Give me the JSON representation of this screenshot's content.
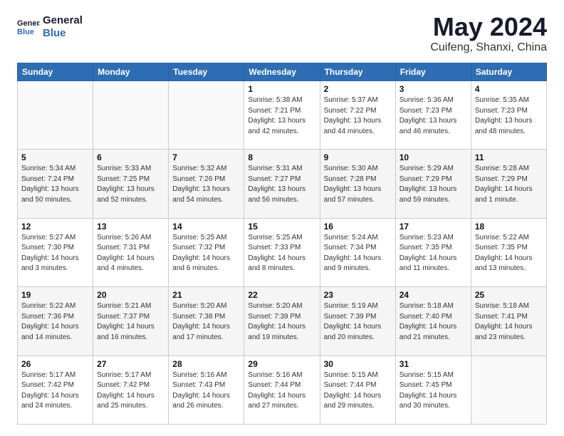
{
  "header": {
    "logo_line1": "General",
    "logo_line2": "Blue",
    "month": "May 2024",
    "location": "Cuifeng, Shanxi, China"
  },
  "weekdays": [
    "Sunday",
    "Monday",
    "Tuesday",
    "Wednesday",
    "Thursday",
    "Friday",
    "Saturday"
  ],
  "weeks": [
    [
      {
        "day": "",
        "info": ""
      },
      {
        "day": "",
        "info": ""
      },
      {
        "day": "",
        "info": ""
      },
      {
        "day": "1",
        "info": "Sunrise: 5:38 AM\nSunset: 7:21 PM\nDaylight: 13 hours\nand 42 minutes."
      },
      {
        "day": "2",
        "info": "Sunrise: 5:37 AM\nSunset: 7:22 PM\nDaylight: 13 hours\nand 44 minutes."
      },
      {
        "day": "3",
        "info": "Sunrise: 5:36 AM\nSunset: 7:23 PM\nDaylight: 13 hours\nand 46 minutes."
      },
      {
        "day": "4",
        "info": "Sunrise: 5:35 AM\nSunset: 7:23 PM\nDaylight: 13 hours\nand 48 minutes."
      }
    ],
    [
      {
        "day": "5",
        "info": "Sunrise: 5:34 AM\nSunset: 7:24 PM\nDaylight: 13 hours\nand 50 minutes."
      },
      {
        "day": "6",
        "info": "Sunrise: 5:33 AM\nSunset: 7:25 PM\nDaylight: 13 hours\nand 52 minutes."
      },
      {
        "day": "7",
        "info": "Sunrise: 5:32 AM\nSunset: 7:26 PM\nDaylight: 13 hours\nand 54 minutes."
      },
      {
        "day": "8",
        "info": "Sunrise: 5:31 AM\nSunset: 7:27 PM\nDaylight: 13 hours\nand 56 minutes."
      },
      {
        "day": "9",
        "info": "Sunrise: 5:30 AM\nSunset: 7:28 PM\nDaylight: 13 hours\nand 57 minutes."
      },
      {
        "day": "10",
        "info": "Sunrise: 5:29 AM\nSunset: 7:29 PM\nDaylight: 13 hours\nand 59 minutes."
      },
      {
        "day": "11",
        "info": "Sunrise: 5:28 AM\nSunset: 7:29 PM\nDaylight: 14 hours\nand 1 minute."
      }
    ],
    [
      {
        "day": "12",
        "info": "Sunrise: 5:27 AM\nSunset: 7:30 PM\nDaylight: 14 hours\nand 3 minutes."
      },
      {
        "day": "13",
        "info": "Sunrise: 5:26 AM\nSunset: 7:31 PM\nDaylight: 14 hours\nand 4 minutes."
      },
      {
        "day": "14",
        "info": "Sunrise: 5:25 AM\nSunset: 7:32 PM\nDaylight: 14 hours\nand 6 minutes."
      },
      {
        "day": "15",
        "info": "Sunrise: 5:25 AM\nSunset: 7:33 PM\nDaylight: 14 hours\nand 8 minutes."
      },
      {
        "day": "16",
        "info": "Sunrise: 5:24 AM\nSunset: 7:34 PM\nDaylight: 14 hours\nand 9 minutes."
      },
      {
        "day": "17",
        "info": "Sunrise: 5:23 AM\nSunset: 7:35 PM\nDaylight: 14 hours\nand 11 minutes."
      },
      {
        "day": "18",
        "info": "Sunrise: 5:22 AM\nSunset: 7:35 PM\nDaylight: 14 hours\nand 13 minutes."
      }
    ],
    [
      {
        "day": "19",
        "info": "Sunrise: 5:22 AM\nSunset: 7:36 PM\nDaylight: 14 hours\nand 14 minutes."
      },
      {
        "day": "20",
        "info": "Sunrise: 5:21 AM\nSunset: 7:37 PM\nDaylight: 14 hours\nand 16 minutes."
      },
      {
        "day": "21",
        "info": "Sunrise: 5:20 AM\nSunset: 7:38 PM\nDaylight: 14 hours\nand 17 minutes."
      },
      {
        "day": "22",
        "info": "Sunrise: 5:20 AM\nSunset: 7:39 PM\nDaylight: 14 hours\nand 19 minutes."
      },
      {
        "day": "23",
        "info": "Sunrise: 5:19 AM\nSunset: 7:39 PM\nDaylight: 14 hours\nand 20 minutes."
      },
      {
        "day": "24",
        "info": "Sunrise: 5:18 AM\nSunset: 7:40 PM\nDaylight: 14 hours\nand 21 minutes."
      },
      {
        "day": "25",
        "info": "Sunrise: 5:18 AM\nSunset: 7:41 PM\nDaylight: 14 hours\nand 23 minutes."
      }
    ],
    [
      {
        "day": "26",
        "info": "Sunrise: 5:17 AM\nSunset: 7:42 PM\nDaylight: 14 hours\nand 24 minutes."
      },
      {
        "day": "27",
        "info": "Sunrise: 5:17 AM\nSunset: 7:42 PM\nDaylight: 14 hours\nand 25 minutes."
      },
      {
        "day": "28",
        "info": "Sunrise: 5:16 AM\nSunset: 7:43 PM\nDaylight: 14 hours\nand 26 minutes."
      },
      {
        "day": "29",
        "info": "Sunrise: 5:16 AM\nSunset: 7:44 PM\nDaylight: 14 hours\nand 27 minutes."
      },
      {
        "day": "30",
        "info": "Sunrise: 5:15 AM\nSunset: 7:44 PM\nDaylight: 14 hours\nand 29 minutes."
      },
      {
        "day": "31",
        "info": "Sunrise: 5:15 AM\nSunset: 7:45 PM\nDaylight: 14 hours\nand 30 minutes."
      },
      {
        "day": "",
        "info": ""
      }
    ]
  ]
}
